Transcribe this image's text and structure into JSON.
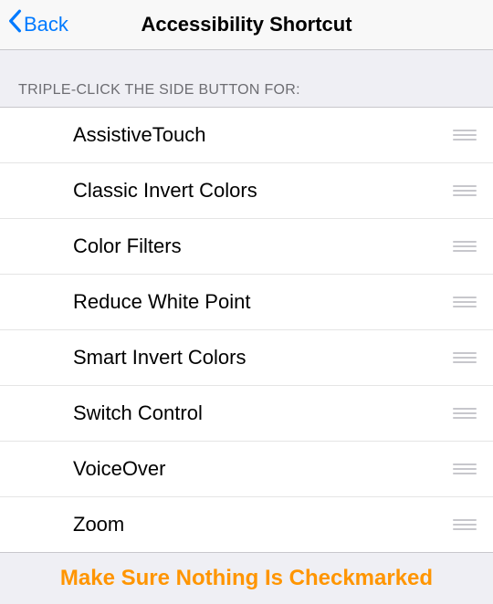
{
  "nav": {
    "back_label": "Back",
    "title": "Accessibility Shortcut"
  },
  "section_header": "TRIPLE-CLICK THE SIDE BUTTON FOR:",
  "items": [
    {
      "label": "AssistiveTouch"
    },
    {
      "label": "Classic Invert Colors"
    },
    {
      "label": "Color Filters"
    },
    {
      "label": "Reduce White Point"
    },
    {
      "label": "Smart Invert Colors"
    },
    {
      "label": "Switch Control"
    },
    {
      "label": "VoiceOver"
    },
    {
      "label": "Zoom"
    }
  ],
  "footer_note": "Make Sure Nothing Is Checkmarked"
}
